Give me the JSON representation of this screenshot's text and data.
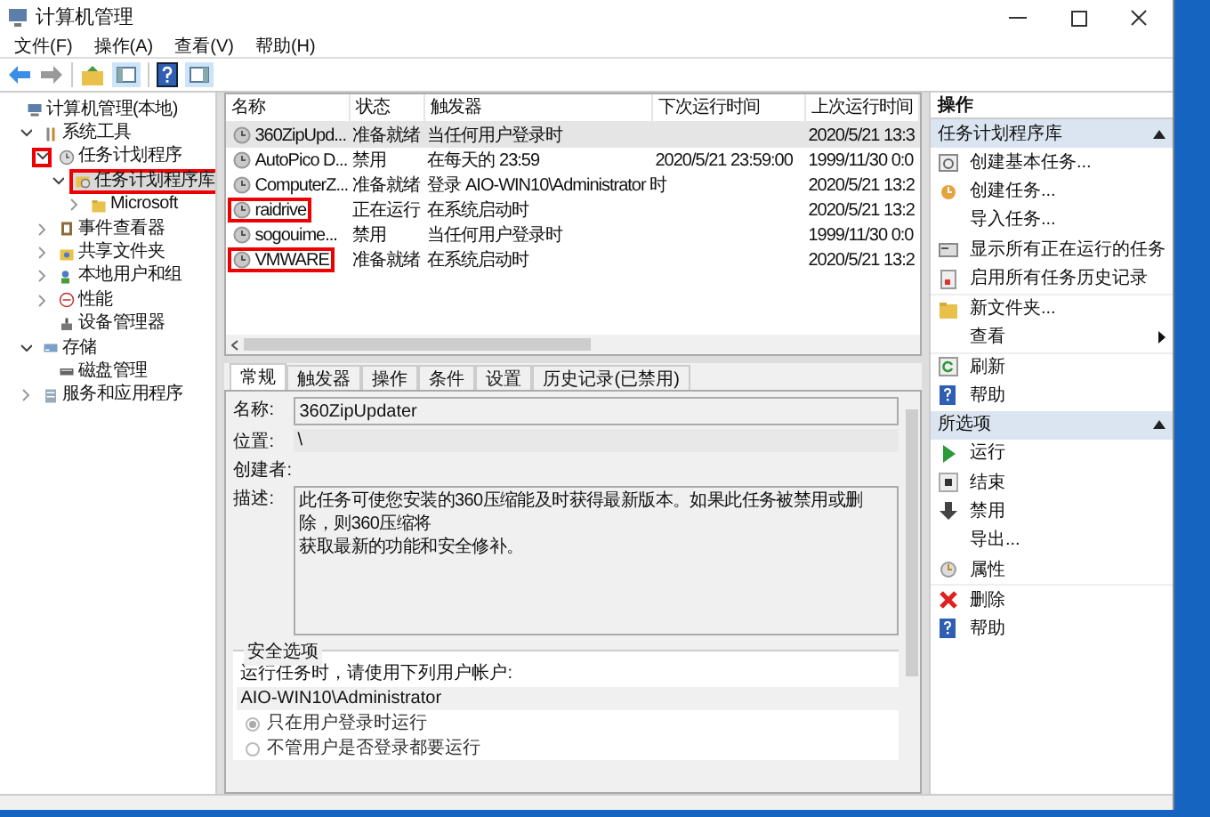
{
  "window": {
    "title": "计算机管理"
  },
  "menu": [
    "文件(F)",
    "操作(A)",
    "查看(V)",
    "帮助(H)"
  ],
  "tree": [
    {
      "label": "计算机管理(本地)",
      "kind": "computer",
      "selected": false,
      "highlighted": false,
      "children": [
        {
          "label": "系统工具",
          "kind": "tools",
          "expanded": true,
          "selected": false,
          "highlighted": false,
          "children": [
            {
              "label": "任务计划程序",
              "kind": "clock",
              "expanded": true,
              "toggle_highlighted": true,
              "selected": false,
              "highlighted": false,
              "children": [
                {
                  "label": "任务计划程序库",
                  "kind": "folder-clock",
                  "expanded": true,
                  "selected": true,
                  "highlighted": true,
                  "children": [
                    {
                      "label": "Microsoft",
                      "kind": "folder",
                      "expanded": false,
                      "selected": false,
                      "highlighted": false
                    }
                  ]
                }
              ]
            },
            {
              "label": "事件查看器",
              "kind": "log",
              "expanded": false,
              "selected": false,
              "highlighted": false
            },
            {
              "label": "共享文件夹",
              "kind": "share",
              "expanded": false,
              "selected": false,
              "highlighted": false
            },
            {
              "label": "本地用户和组",
              "kind": "users",
              "expanded": false,
              "selected": false,
              "highlighted": false
            },
            {
              "label": "性能",
              "kind": "perf",
              "expanded": false,
              "selected": false,
              "highlighted": false
            },
            {
              "label": "设备管理器",
              "kind": "device",
              "selected": false,
              "highlighted": false
            }
          ]
        },
        {
          "label": "存储",
          "kind": "storage",
          "expanded": true,
          "selected": false,
          "highlighted": false,
          "children": [
            {
              "label": "磁盘管理",
              "kind": "disk",
              "selected": false,
              "highlighted": false
            }
          ]
        },
        {
          "label": "服务和应用程序",
          "kind": "services",
          "expanded": false,
          "selected": false,
          "highlighted": false
        }
      ]
    }
  ],
  "table": {
    "columns": [
      "名称",
      "状态",
      "触发器",
      "下次运行时间",
      "上次运行时间"
    ],
    "rows": [
      {
        "selected": true,
        "highlighted": false,
        "cells": [
          "360ZipUpd...",
          "准备就绪",
          "当任何用户登录时",
          "",
          "2020/5/21 13:3"
        ]
      },
      {
        "selected": false,
        "highlighted": false,
        "cells": [
          "AutoPico D...",
          "禁用",
          "在每天的 23:59",
          "2020/5/21 23:59:00",
          "1999/11/30 0:0"
        ]
      },
      {
        "selected": false,
        "highlighted": false,
        "cells": [
          "ComputerZ...",
          "准备就绪",
          "登录 AIO-WIN10\\Administrator 时",
          "",
          "2020/5/21 13:2"
        ]
      },
      {
        "selected": false,
        "highlighted": true,
        "cells": [
          "raidrive",
          "正在运行",
          "在系统启动时",
          "",
          "2020/5/21 13:2"
        ]
      },
      {
        "selected": false,
        "highlighted": false,
        "cells": [
          "sogouime...",
          "禁用",
          "当任何用户登录时",
          "",
          "1999/11/30 0:0"
        ]
      },
      {
        "selected": false,
        "highlighted": true,
        "cells": [
          "VMWARE",
          "准备就绪",
          "在系统启动时",
          "",
          "2020/5/21 13:2"
        ]
      }
    ]
  },
  "detail_tabs": [
    {
      "label": "常规",
      "selected": true
    },
    {
      "label": "触发器",
      "selected": false
    },
    {
      "label": "操作",
      "selected": false
    },
    {
      "label": "条件",
      "selected": false
    },
    {
      "label": "设置",
      "selected": false
    },
    {
      "label": "历史记录(已禁用)",
      "selected": false
    }
  ],
  "general": {
    "name_label": "名称:",
    "name_value": "360ZipUpdater",
    "location_label": "位置:",
    "location_value": "\\",
    "author_label": "创建者:",
    "description_label": "描述:",
    "description_lines": [
      "此任务可使您安装的360压缩能及时获得最新版本。如果此任务被禁用或删除，则360压缩将",
      "获取最新的功能和安全修补。"
    ],
    "security": {
      "title": "安全选项",
      "prompt": "运行任务时，请使用下列用户帐户:",
      "account": "AIO-WIN10\\Administrator",
      "options": [
        {
          "label": "只在用户登录时运行",
          "selected": true
        },
        {
          "label": "不管用户是否登录都要运行",
          "selected": false
        }
      ]
    }
  },
  "actions": {
    "title": "操作",
    "sections": [
      {
        "title": "任务计划程序库",
        "expanded": true,
        "items": [
          {
            "label": "创建基本任务..."
          },
          {
            "label": "创建任务..."
          },
          {
            "label": "导入任务..."
          },
          {
            "label": "显示所有正在运行的任务"
          },
          {
            "label": "启用所有任务历史记录"
          },
          {
            "label": "新文件夹..."
          },
          {
            "label": "查看",
            "submenu": true
          },
          {
            "label": "刷新"
          },
          {
            "label": "帮助"
          }
        ]
      },
      {
        "title": "所选项",
        "expanded": true,
        "items": [
          {
            "label": "运行"
          },
          {
            "label": "结束"
          },
          {
            "label": "禁用"
          },
          {
            "label": "导出..."
          },
          {
            "label": "属性"
          },
          {
            "label": "删除"
          },
          {
            "label": "帮助"
          }
        ]
      }
    ]
  }
}
